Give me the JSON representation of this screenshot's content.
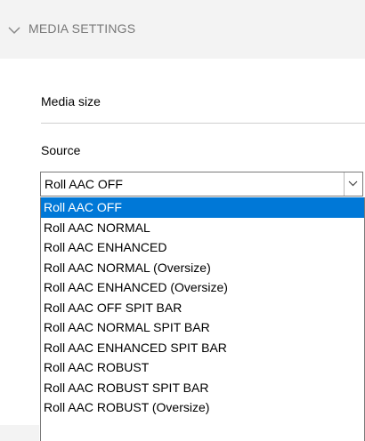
{
  "section": {
    "title": "MEDIA SETTINGS",
    "toggle_icon": "chevron-down-icon"
  },
  "media_size": {
    "label": "Media size"
  },
  "source": {
    "label": "Source",
    "selected_value": "Roll AAC OFF",
    "dropdown_icon": "chevron-down-icon",
    "options": [
      "Roll AAC OFF",
      "Roll AAC NORMAL",
      "Roll AAC ENHANCED",
      "Roll AAC NORMAL (Oversize)",
      "Roll AAC ENHANCED (Oversize)",
      "Roll AAC OFF SPIT BAR",
      "Roll AAC NORMAL SPIT BAR",
      "Roll AAC ENHANCED SPIT BAR",
      "Roll AAC ROBUST",
      "Roll AAC ROBUST SPIT BAR",
      "Roll AAC ROBUST (Oversize)"
    ],
    "selected_index": 0
  },
  "colors": {
    "selection_background": "#0078d7",
    "selection_text": "#ffffff",
    "header_background": "#f3f3f3",
    "header_text": "#777777"
  }
}
